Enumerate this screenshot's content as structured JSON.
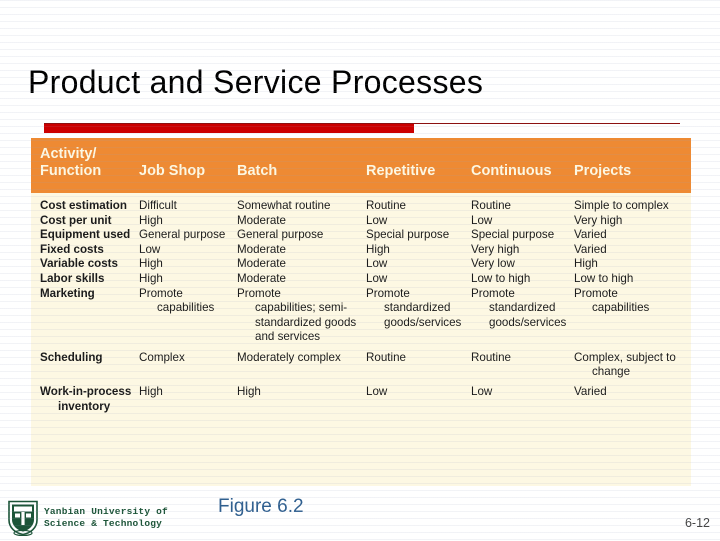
{
  "slide": {
    "title": "Product and Service Processes",
    "figure_caption": "Figure 6.2",
    "page_number": "6-12",
    "colors": {
      "header_band": "#ee8a33",
      "panel_background": "#fdf8e3",
      "accent_red_bar": "#cc0000",
      "accent_thin_line": "#8c1111",
      "caption_blue": "#2f5f8f",
      "logo_green": "#1c5438"
    }
  },
  "footer": {
    "university_line1": "Yanbian University of",
    "university_line2": "Science & Technology",
    "logo_icon": "university-crest-icon"
  },
  "table": {
    "columns": [
      "Activity/ Function",
      "Job Shop",
      "Batch",
      "Repetitive",
      "Continuous",
      "Projects"
    ],
    "column_header_lines": [
      [
        "Activity/",
        "Function"
      ],
      [
        "Job Shop"
      ],
      [
        "Batch"
      ],
      [
        "Repetitive"
      ],
      [
        "Continuous"
      ],
      [
        "Projects"
      ]
    ],
    "rows": [
      {
        "label": "Cost estimation",
        "label_lines": [
          "Cost estimation"
        ],
        "cells": [
          [
            "Difficult"
          ],
          [
            "Somewhat routine"
          ],
          [
            "Routine"
          ],
          [
            "Routine"
          ],
          [
            "Simple to complex"
          ]
        ]
      },
      {
        "label": "Cost per unit",
        "label_lines": [
          "Cost per unit"
        ],
        "cells": [
          [
            "High"
          ],
          [
            "Moderate"
          ],
          [
            "Low"
          ],
          [
            "Low"
          ],
          [
            "Very high"
          ]
        ]
      },
      {
        "label": "Equipment used",
        "label_lines": [
          "Equipment used"
        ],
        "cells": [
          [
            "General purpose"
          ],
          [
            "General purpose"
          ],
          [
            "Special purpose"
          ],
          [
            "Special purpose"
          ],
          [
            "Varied"
          ]
        ]
      },
      {
        "label": "Fixed costs",
        "label_lines": [
          "Fixed costs"
        ],
        "cells": [
          [
            "Low"
          ],
          [
            "Moderate"
          ],
          [
            "High"
          ],
          [
            "Very high"
          ],
          [
            "Varied"
          ]
        ]
      },
      {
        "label": "Variable costs",
        "label_lines": [
          "Variable costs"
        ],
        "cells": [
          [
            "High"
          ],
          [
            "Moderate"
          ],
          [
            "Low"
          ],
          [
            "Very low"
          ],
          [
            "High"
          ]
        ]
      },
      {
        "label": "Labor skills",
        "label_lines": [
          "Labor skills"
        ],
        "cells": [
          [
            "High"
          ],
          [
            "Moderate"
          ],
          [
            "Low"
          ],
          [
            "Low to high"
          ],
          [
            "Low to high"
          ]
        ]
      },
      {
        "label": "Marketing",
        "label_lines": [
          "Marketing"
        ],
        "cells": [
          [
            "Promote",
            "capabilities"
          ],
          [
            "Promote",
            "capabilities; semi-",
            "standardized goods",
            "and services"
          ],
          [
            "Promote",
            "standardized",
            "goods/services"
          ],
          [
            "Promote",
            "standardized",
            "goods/services"
          ],
          [
            "Promote",
            "capabilities"
          ]
        ]
      },
      {
        "label": "Scheduling",
        "label_lines": [
          "Scheduling"
        ],
        "cells": [
          [
            "Complex"
          ],
          [
            "Moderately complex"
          ],
          [
            "Routine"
          ],
          [
            "Routine"
          ],
          [
            "Complex, subject to",
            "change"
          ]
        ]
      },
      {
        "label": "Work-in-process inventory",
        "label_lines": [
          "Work-in-process",
          "inventory"
        ],
        "cells": [
          [
            "High"
          ],
          [
            "High"
          ],
          [
            "Low"
          ],
          [
            "Low"
          ],
          [
            "Varied"
          ]
        ]
      }
    ]
  }
}
